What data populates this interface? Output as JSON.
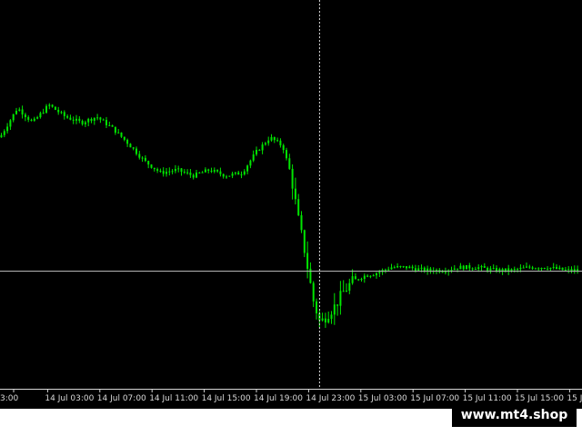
{
  "chart_data": {
    "type": "candlestick",
    "title": "",
    "xlabel": "",
    "ylabel": "",
    "grid": false,
    "colors": {
      "background": "#000000",
      "candle": "#00e600",
      "price_line": "#b4b4b4",
      "period_separator": "#e0e0e0",
      "axis_text": "#d8d8d8"
    },
    "x_ticks": [
      "3:00",
      "14 Jul 03:00",
      "14 Jul 07:00",
      "14 Jul 11:00",
      "14 Jul 15:00",
      "14 Jul 19:00",
      "14 Jul 23:00",
      "15 Jul 03:00",
      "15 Jul 07:00",
      "15 Jul 11:00",
      "15 Jul 15:00",
      "15 Jul 19:"
    ],
    "y_range": [
      0,
      100
    ],
    "current_price": 30,
    "separator_after_label": "14 Jul 23:00",
    "price_path": [
      [
        0,
        75
      ],
      [
        1.5,
        85
      ],
      [
        2.8,
        80
      ],
      [
        4.2,
        86
      ],
      [
        5.6,
        82
      ],
      [
        7.0,
        80
      ],
      [
        8.3,
        82
      ],
      [
        9.7,
        78
      ],
      [
        11.0,
        73
      ],
      [
        12.4,
        67
      ],
      [
        13.8,
        63
      ],
      [
        15.2,
        64
      ],
      [
        16.6,
        62
      ],
      [
        18.0,
        64
      ],
      [
        19.4,
        62
      ],
      [
        20.8,
        63
      ],
      [
        22.0,
        70
      ],
      [
        23.2,
        75
      ],
      [
        24.3,
        72
      ],
      [
        25.0,
        62
      ],
      [
        25.6,
        48
      ],
      [
        26.2,
        36
      ],
      [
        26.9,
        20
      ],
      [
        27.5,
        12
      ],
      [
        28.1,
        15
      ],
      [
        28.8,
        18
      ],
      [
        29.4,
        22
      ],
      [
        30.2,
        26
      ],
      [
        31.2,
        28
      ],
      [
        32.3,
        29
      ],
      [
        33.6,
        31
      ],
      [
        35.0,
        31
      ],
      [
        36.5,
        30
      ],
      [
        38.0,
        30
      ],
      [
        39.5,
        31
      ],
      [
        41.0,
        31
      ],
      [
        42.5,
        30
      ],
      [
        44.0,
        30
      ],
      [
        45.5,
        31
      ],
      [
        47.0,
        31
      ],
      [
        48.5,
        30
      ],
      [
        50.0,
        30
      ]
    ]
  },
  "watermark": {
    "text": "www.mt4.shop"
  }
}
